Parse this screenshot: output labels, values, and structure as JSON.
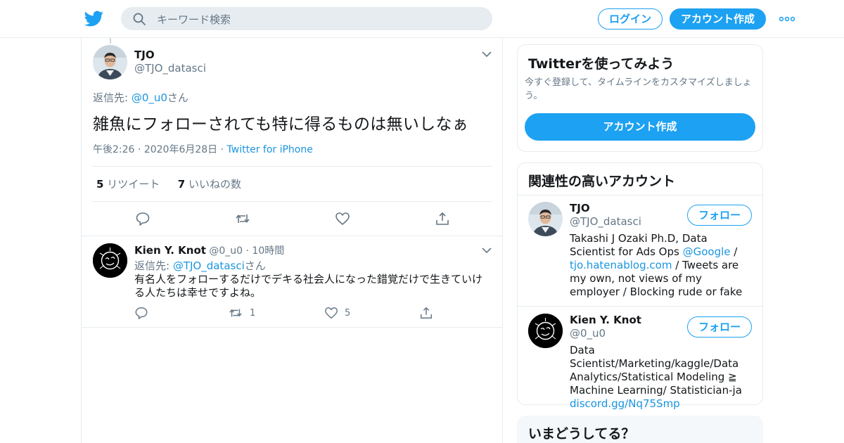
{
  "header": {
    "search_placeholder": "キーワード検索",
    "login_label": "ログイン",
    "signup_label": "アカウント作成",
    "brand_color": "#1da1f2"
  },
  "tweet": {
    "name": "TJO",
    "handle": "@TJO_datasci",
    "reply_prefix": "返信先: ",
    "reply_to": "@0_u0",
    "reply_suffix": "さん",
    "text": "雑魚にフォローされても特に得るものは無いしなぁ",
    "time": "午後2:26",
    "date": "2020年6月28日",
    "source": "Twitter for iPhone",
    "retweet_count": "5",
    "retweet_label": "リツイート",
    "like_count": "7",
    "like_label": "いいねの数"
  },
  "reply": {
    "name": "Kien Y. Knot",
    "handle": "@0_u0",
    "time": "10時間",
    "reply_prefix": "返信先: ",
    "reply_to": "@TJO_datasci",
    "reply_suffix": "さん",
    "text": "有名人をフォローするだけでデキる社会人になった錯覚だけで生きていける人たちは幸せですよね。",
    "retweet_count": "1",
    "like_count": "5"
  },
  "sidebar": {
    "signup_card": {
      "title": "Twitterを使ってみよう",
      "description": "今すぐ登録して、タイムラインをカスタマイズしましょう。",
      "button": "アカウント作成"
    },
    "related": {
      "title": "関連性の高いアカウント",
      "follow_label": "フォロー",
      "accounts": [
        {
          "name": "TJO",
          "handle": "@TJO_datasci",
          "bio_1": "Takashi J Ozaki Ph.D, Data Scientist for Ads Ops ",
          "bio_link_1": "@Google",
          "bio_2": " /",
          "bio_link_2": "tjo.hatenablog.com",
          "bio_3": " / Tweets are my own, not views of my employer / Blocking rude or fake"
        },
        {
          "name": "Kien Y. Knot",
          "handle": "@0_u0",
          "bio_1": "Data Scientist/Marketing/kaggle/Data Analytics/Statistical Modeling ≧ Machine Learning/ Statistician-ja",
          "bio_link_1": "discord.gg/Nq75Smp"
        }
      ]
    },
    "trends_card": {
      "title": "いまどうしてる？"
    }
  }
}
